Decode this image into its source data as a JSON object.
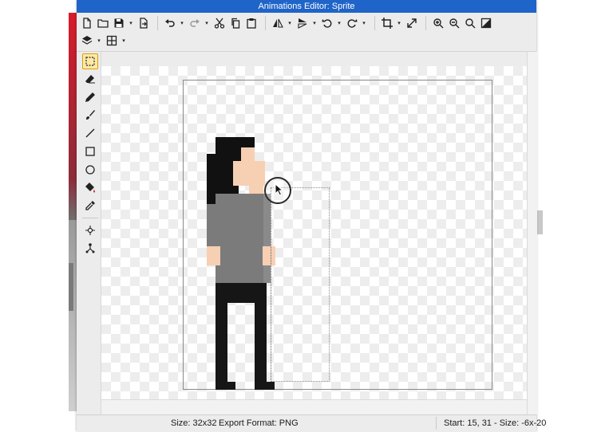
{
  "window": {
    "title": "Animations Editor: Sprite"
  },
  "toolbar": {
    "row1": [
      {
        "name": "new-file-icon",
        "dropdown": false
      },
      {
        "name": "open-folder-icon",
        "dropdown": false
      },
      {
        "name": "save-icon",
        "dropdown": true
      },
      {
        "name": "export-icon",
        "dropdown": false
      },
      {
        "name": "undo-icon",
        "dropdown": true
      },
      {
        "name": "redo-icon",
        "dropdown": true
      },
      {
        "name": "cut-icon",
        "dropdown": false
      },
      {
        "name": "copy-icon",
        "dropdown": false
      },
      {
        "name": "paste-icon",
        "dropdown": false
      },
      {
        "name": "flip-horizontal-icon",
        "dropdown": true
      },
      {
        "name": "flip-vertical-icon",
        "dropdown": true
      },
      {
        "name": "rotate-left-icon",
        "dropdown": true
      },
      {
        "name": "rotate-right-icon",
        "dropdown": true
      },
      {
        "name": "crop-icon",
        "dropdown": true
      },
      {
        "name": "resize-icon",
        "dropdown": false
      },
      {
        "name": "zoom-in-icon",
        "dropdown": false
      },
      {
        "name": "zoom-out-icon",
        "dropdown": false
      },
      {
        "name": "zoom-fit-icon",
        "dropdown": false
      },
      {
        "name": "toggle-background-icon",
        "dropdown": false
      }
    ],
    "row2": [
      {
        "name": "layers-icon",
        "dropdown": true
      },
      {
        "name": "grid-icon",
        "dropdown": true
      }
    ]
  },
  "tools": [
    {
      "name": "rectangle-select-icon",
      "active": true
    },
    {
      "name": "eraser-icon",
      "active": false
    },
    {
      "name": "pencil-icon",
      "active": false
    },
    {
      "name": "brush-icon",
      "active": false
    },
    {
      "name": "line-icon",
      "active": false
    },
    {
      "name": "rectangle-icon",
      "active": false
    },
    {
      "name": "ellipse-icon",
      "active": false
    },
    {
      "name": "fill-bucket-icon",
      "active": false
    },
    {
      "name": "eyedropper-icon",
      "active": false
    },
    {
      "name": "origin-point-icon",
      "active": false
    },
    {
      "name": "skeleton-icon",
      "active": false
    }
  ],
  "sprite_colors": {
    "hair": "#111111",
    "skin": "#f7cfb3",
    "shirt": "#7b7b7b",
    "pants": "#161616",
    "frame_border": "#8a8a8a"
  },
  "status": {
    "size": "Size: 32x32",
    "format": "Export Format: PNG",
    "selection": "Start: 15, 31 - Size: -6x-20"
  },
  "colors": {
    "titlebar": "#1f64c8",
    "active_tool_bg": "#ffe9a6",
    "active_tool_border": "#e0a000"
  }
}
